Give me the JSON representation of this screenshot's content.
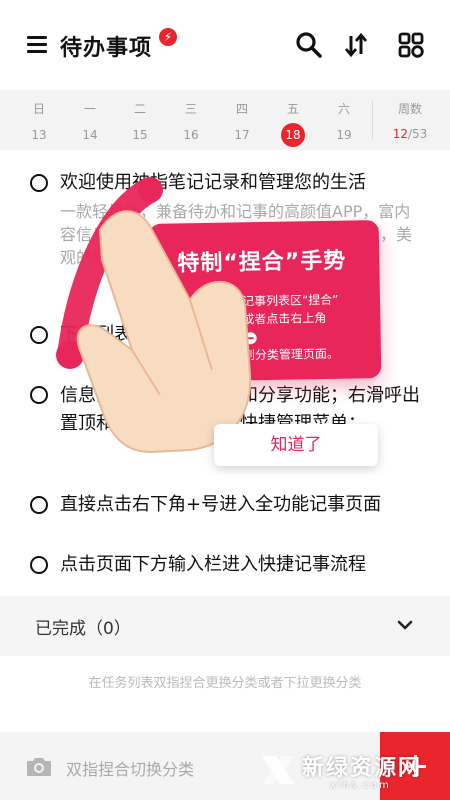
{
  "header": {
    "title": "待办事项",
    "bolt_icon": "lightning-bolt-icon",
    "menu_icon": "menu-icon",
    "search_icon": "search-icon",
    "sort_icon": "sort-arrows-icon",
    "grid_icon": "category-grid-icon"
  },
  "week": {
    "days": [
      {
        "name": "日",
        "date": "13"
      },
      {
        "name": "一",
        "date": "14"
      },
      {
        "name": "二",
        "date": "15"
      },
      {
        "name": "三",
        "date": "16"
      },
      {
        "name": "四",
        "date": "17"
      },
      {
        "name": "五",
        "date": "18",
        "selected": true
      },
      {
        "name": "六",
        "date": "19"
      }
    ],
    "week_label": "周数",
    "week_current": "12",
    "week_total": "/53"
  },
  "tasks": [
    {
      "title": "欢迎使用神指笔记记录和管理您的生活",
      "desc": "一款轻量级，兼备待办和记事的高颜值APP，富内容信息记录，手势操控，支持多种的手势交互，美观的界面设计，记录您的精致生活的每一刻"
    },
    {
      "title": "下拉列表，可以查看更多分类"
    },
    {
      "title": "信息流列表，支持删除和分享功能；右滑呼出置顶和迁移；长按呼出快捷管理菜单；"
    },
    {
      "title": "直接点击右下角+号进入全功能记事页面"
    },
    {
      "title": "点击页面下方输入栏进入快捷记事流程"
    }
  ],
  "completed": {
    "label": "已完成（0）",
    "chevron_icon": "chevron-down-icon"
  },
  "hint": "在任务列表双指捏合更换分类或者下拉更换分类",
  "bottom": {
    "camera_icon": "camera-icon",
    "placeholder": "双指捏合切换分类",
    "plus_icon": "plus-icon"
  },
  "overlay": {
    "title": "特制“捏合”手势",
    "line1": "记事列表区“捏合”",
    "line2": "或者点击右上角",
    "line3": "到分类管理页面。",
    "button": "知道了",
    "hand_icon": "pinch-hand-icon"
  },
  "watermark": {
    "text": "新绿资源网",
    "sub": "xlhs.com"
  },
  "colors": {
    "accent": "#e8262c",
    "overlay_pink": "#e8265a"
  }
}
